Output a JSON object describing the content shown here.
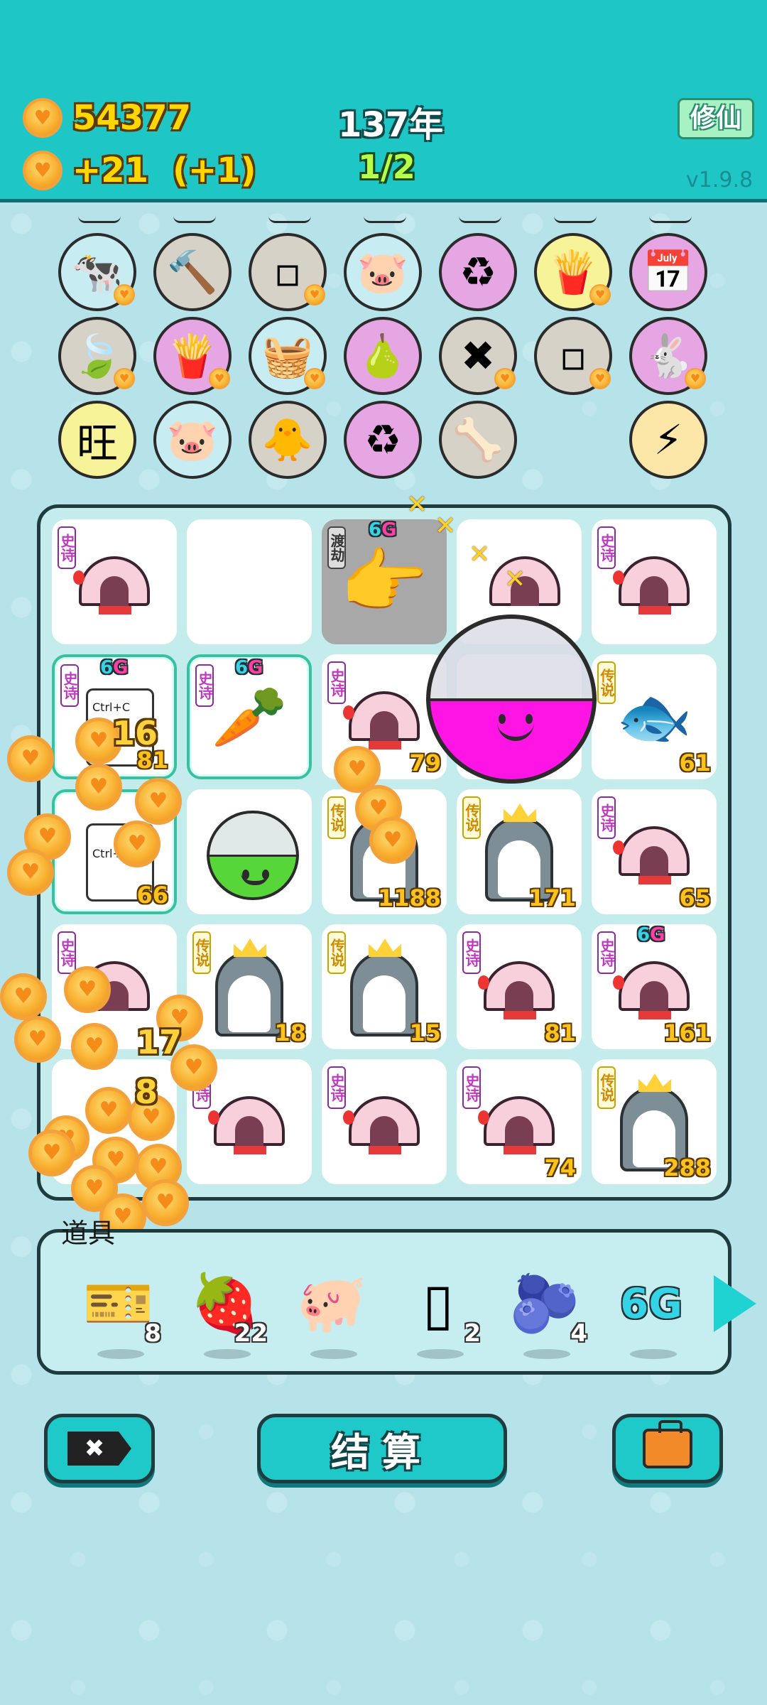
{
  "header": {
    "coins": "54377",
    "income": "+21",
    "income_bonus": "(+1)",
    "year": "137年",
    "progress": "1/2",
    "xiuxian_label": "修仙",
    "version": "v1.9.8"
  },
  "symbols": [
    {
      "name": "cow-pair-icon",
      "emoji": "🐄",
      "bg": "#c7ecf2",
      "coin": true
    },
    {
      "name": "hammer-icon",
      "emoji": "🔨",
      "bg": "#d6d2c7",
      "coin": false
    },
    {
      "name": "sugar-cubes-icon",
      "emoji": "▫",
      "bg": "#d6d2c7",
      "coin": true
    },
    {
      "name": "piggy-bank-icon",
      "emoji": "🐷",
      "bg": "#c7ecf2",
      "coin": false
    },
    {
      "name": "recycle-icon",
      "emoji": "♻",
      "bg": "#e5a6e3",
      "coin": false
    },
    {
      "name": "fries-icon",
      "emoji": "🍟",
      "bg": "#f7f399",
      "coin": true
    },
    {
      "name": "calendar-icon",
      "emoji": "📅",
      "bg": "#e5a6e3",
      "coin": false
    },
    {
      "name": "leaf-icon",
      "emoji": "🍃",
      "bg": "#d6d2c7",
      "coin": true
    },
    {
      "name": "fries-icon",
      "emoji": "🍟",
      "bg": "#e5a6e3",
      "coin": true
    },
    {
      "name": "fruit-basket-icon",
      "emoji": "🧺",
      "bg": "#c7ecf2",
      "coin": true
    },
    {
      "name": "guava-icon",
      "emoji": "🍐",
      "bg": "#e5a6e3",
      "coin": false
    },
    {
      "name": "delete-tag-icon",
      "emoji": "✖",
      "bg": "#d6d2c7",
      "coin": true
    },
    {
      "name": "sugar-cubes-icon",
      "emoji": "▫",
      "bg": "#d6d2c7",
      "coin": true
    },
    {
      "name": "rabbit-icon",
      "emoji": "🐇",
      "bg": "#e5a6e3",
      "coin": true
    },
    {
      "name": "wang-text-icon",
      "emoji": "旺",
      "bg": "#f7f399",
      "coin": false
    },
    {
      "name": "piggy-bank-icon",
      "emoji": "🐷",
      "bg": "#c7ecf2",
      "coin": false
    },
    {
      "name": "chick-egg-icon",
      "emoji": "🐥",
      "bg": "#d6d2c7",
      "coin": false
    },
    {
      "name": "recycle-icon",
      "emoji": "♻",
      "bg": "#e5a6e3",
      "coin": false
    },
    {
      "name": "pet-bowl-icon",
      "emoji": "🦴",
      "bg": "#d6d2c7",
      "coin": false
    },
    {
      "name": "lightning-icon",
      "emoji": "⚡",
      "bg": "#fce6a8",
      "coin": false
    }
  ],
  "grid": {
    "rarity_epic": "史诗",
    "rarity_legend": "传说",
    "tag_dujie": "渡劫",
    "sixg_a": "6",
    "sixg_b": "G",
    "ctrl_c": "Ctrl+C",
    "ctrl_v": "Ctrl+",
    "counts": {
      "r2c1": "81",
      "r2c3": "79",
      "r2c5": "61",
      "r3c1": "66",
      "r3c3": "1188",
      "r3c4": "171",
      "r3c5": "65",
      "r4c2": "18",
      "r4c3": "15",
      "r4c4": "81",
      "r4c5": "161",
      "r5c4": "74",
      "r5c5": "288"
    },
    "float_nums": [
      "16",
      "17",
      "8"
    ]
  },
  "items": {
    "label": "道具",
    "list": [
      {
        "name": "lottery-tickets-icon",
        "emoji": "🎫",
        "qty": "8"
      },
      {
        "name": "lychee-icon",
        "emoji": "🍓",
        "qty": "22"
      },
      {
        "name": "pink-piggy-icon",
        "emoji": "🐖",
        "qty": ""
      },
      {
        "name": "empty-tickets-icon",
        "emoji": "▯",
        "qty": "2"
      },
      {
        "name": "blueberry-icon",
        "emoji": "🫐",
        "qty": "4"
      },
      {
        "name": "sixg-icon",
        "emoji": "6G",
        "qty": ""
      }
    ]
  },
  "buttons": {
    "settle_label": "结算"
  }
}
